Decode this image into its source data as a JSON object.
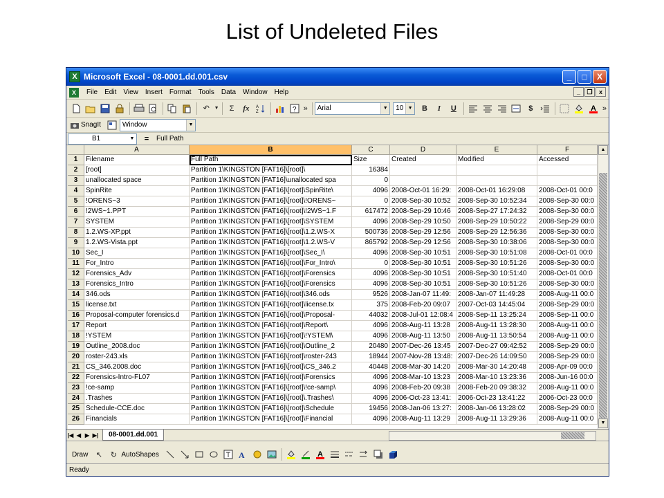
{
  "slide_title": "List of Undeleted Files",
  "window": {
    "title": "Microsoft Excel - 08-0001.dd.001.csv",
    "app_icon": "X",
    "minimize_glyph": "_",
    "maximize_glyph": "□",
    "close_glyph": "X"
  },
  "menubar": {
    "items": [
      "File",
      "Edit",
      "View",
      "Insert",
      "Format",
      "Tools",
      "Data",
      "Window",
      "Help"
    ],
    "doc_minimize": "_",
    "doc_restore": "❐",
    "doc_close": "x"
  },
  "toolbar1": {
    "font_name": "Arial",
    "font_size": "10",
    "bold": "B",
    "italic": "I",
    "underline": "U",
    "sigma": "Σ",
    "fx": "fx",
    "currency": "$",
    "more": "»"
  },
  "toolbar2": {
    "snagit_label": "SnagIt",
    "capture_mode": "Window"
  },
  "formula_bar": {
    "cell_ref": "B1",
    "equals": "=",
    "value": "Full Path"
  },
  "columns": [
    "A",
    "B",
    "C",
    "D",
    "E",
    "F"
  ],
  "rows": [
    {
      "n": "1",
      "a": "Filename",
      "b": "Full Path",
      "c": "Size",
      "d": "Created",
      "e": "Modified",
      "f": "Accessed",
      "c_text": true
    },
    {
      "n": "2",
      "a": "[root]",
      "b": "Partition 1\\KINGSTON [FAT16]\\[root]\\",
      "c": "16384",
      "d": "",
      "e": "",
      "f": ""
    },
    {
      "n": "3",
      "a": "unallocated space",
      "b": "Partition 1\\KINGSTON [FAT16]\\unallocated spa",
      "c": "0",
      "d": "",
      "e": "",
      "f": ""
    },
    {
      "n": "4",
      "a": "SpinRite",
      "b": "Partition 1\\KINGSTON [FAT16]\\[root]\\SpinRite\\",
      "c": "4096",
      "d": "2008-Oct-01 16:29:",
      "e": "2008-Oct-01 16:29:08",
      "f": "2008-Oct-01 00:0"
    },
    {
      "n": "5",
      "a": "!ORENS~3",
      "b": "Partition 1\\KINGSTON [FAT16]\\[root]\\!ORENS~",
      "c": "0",
      "d": "2008-Sep-30 10:52",
      "e": "2008-Sep-30 10:52:34",
      "f": "2008-Sep-30 00:0"
    },
    {
      "n": "6",
      "a": "!2WS~1.PPT",
      "b": "Partition 1\\KINGSTON [FAT16]\\[root]\\!2WS~1.F",
      "c": "617472",
      "d": "2008-Sep-29 10:46",
      "e": "2008-Sep-27 17:24:32",
      "f": "2008-Sep-30 00:0"
    },
    {
      "n": "7",
      "a": "SYSTEM",
      "b": "Partition 1\\KINGSTON [FAT16]\\[root]\\SYSTEM",
      "c": "4096",
      "d": "2008-Sep-29 10:50",
      "e": "2008-Sep-29 10:50:22",
      "f": "2008-Sep-29 00:0"
    },
    {
      "n": "8",
      "a": "1.2.WS-XP.ppt",
      "b": "Partition 1\\KINGSTON [FAT16]\\[root]\\1.2.WS-X",
      "c": "500736",
      "d": "2008-Sep-29 12:56",
      "e": "2008-Sep-29 12:56:36",
      "f": "2008-Sep-30 00:0"
    },
    {
      "n": "9",
      "a": "1.2.WS-Vista.ppt",
      "b": "Partition 1\\KINGSTON [FAT16]\\[root]\\1.2.WS-V",
      "c": "865792",
      "d": "2008-Sep-29 12:56",
      "e": "2008-Sep-30 10:38:06",
      "f": "2008-Sep-30 00:0"
    },
    {
      "n": "10",
      "a": "Sec_I",
      "b": "Partition 1\\KINGSTON [FAT16]\\[root]\\Sec_I\\",
      "c": "4096",
      "d": "2008-Sep-30 10:51",
      "e": "2008-Sep-30 10:51:08",
      "f": "2008-Oct-01 00:0"
    },
    {
      "n": "11",
      "a": "For_Intro",
      "b": "Partition 1\\KINGSTON [FAT16]\\[root]\\For_Intro\\",
      "c": "0",
      "d": "2008-Sep-30 10:51",
      "e": "2008-Sep-30 10:51:26",
      "f": "2008-Sep-30 00:0"
    },
    {
      "n": "12",
      "a": "Forensics_Adv",
      "b": "Partition 1\\KINGSTON [FAT16]\\[root]\\Forensics",
      "c": "4096",
      "d": "2008-Sep-30 10:51",
      "e": "2008-Sep-30 10:51:40",
      "f": "2008-Oct-01 00:0"
    },
    {
      "n": "13",
      "a": "Forensics_Intro",
      "b": "Partition 1\\KINGSTON [FAT16]\\[root]\\Forensics",
      "c": "4096",
      "d": "2008-Sep-30 10:51",
      "e": "2008-Sep-30 10:51:26",
      "f": "2008-Sep-30 00:0"
    },
    {
      "n": "14",
      "a": "346.ods",
      "b": "Partition 1\\KINGSTON [FAT16]\\[root]\\346.ods",
      "c": "9526",
      "d": "2008-Jan-07 11:49:",
      "e": "2008-Jan-07 11:49:28",
      "f": "2008-Aug-11 00:0"
    },
    {
      "n": "15",
      "a": "license.txt",
      "b": "Partition 1\\KINGSTON [FAT16]\\[root]\\license.tx",
      "c": "375",
      "d": "2008-Feb-20 09:07",
      "e": "2007-Oct-03 14:45:04",
      "f": "2008-Sep-29 00:0"
    },
    {
      "n": "16",
      "a": "Proposal-computer forensics.d",
      "b": "Partition 1\\KINGSTON [FAT16]\\[root]\\Proposal-",
      "c": "44032",
      "d": "2008-Jul-01 12:08:4",
      "e": "2008-Sep-11 13:25:24",
      "f": "2008-Sep-11 00:0"
    },
    {
      "n": "17",
      "a": "Report",
      "b": "Partition 1\\KINGSTON [FAT16]\\[root]\\Report\\",
      "c": "4096",
      "d": "2008-Aug-11 13:28",
      "e": "2008-Aug-11 13:28:30",
      "f": "2008-Aug-11 00:0"
    },
    {
      "n": "18",
      "a": "!YSTEM",
      "b": "Partition 1\\KINGSTON [FAT16]\\[root]\\!YSTEM\\",
      "c": "4096",
      "d": "2008-Aug-11 13:50",
      "e": "2008-Aug-11 13:50:54",
      "f": "2008-Aug-11 00:0"
    },
    {
      "n": "19",
      "a": "Outline_2008.doc",
      "b": "Partition 1\\KINGSTON [FAT16]\\[root]\\Outline_2",
      "c": "20480",
      "d": "2007-Dec-26 13:45",
      "e": "2007-Dec-27 09:42:52",
      "f": "2008-Sep-29 00:0"
    },
    {
      "n": "20",
      "a": "roster-243.xls",
      "b": "Partition 1\\KINGSTON [FAT16]\\[root]\\roster-243",
      "c": "18944",
      "d": "2007-Nov-28 13:48:",
      "e": "2007-Dec-26 14:09:50",
      "f": "2008-Sep-29 00:0"
    },
    {
      "n": "21",
      "a": "CS_346.2008.doc",
      "b": "Partition 1\\KINGSTON [FAT16]\\[root]\\CS_346.2",
      "c": "40448",
      "d": "2008-Mar-30 14:20",
      "e": "2008-Mar-30 14:20:48",
      "f": "2008-Apr-09 00:0"
    },
    {
      "n": "22",
      "a": "Forensics-Intro-FL07",
      "b": "Partition 1\\KINGSTON [FAT16]\\[root]\\Forensics",
      "c": "4096",
      "d": "2008-Mar-10 13:23",
      "e": "2008-Mar-10 13:23:36",
      "f": "2008-Jun-16 00:0"
    },
    {
      "n": "23",
      "a": "!ce-samp",
      "b": "Partition 1\\KINGSTON [FAT16]\\[root]\\!ce-samp\\",
      "c": "4096",
      "d": "2008-Feb-20 09:38",
      "e": "2008-Feb-20 09:38:32",
      "f": "2008-Aug-11 00:0"
    },
    {
      "n": "24",
      "a": ".Trashes",
      "b": "Partition 1\\KINGSTON [FAT16]\\[root]\\.Trashes\\",
      "c": "4096",
      "d": "2006-Oct-23 13:41:",
      "e": "2006-Oct-23 13:41:22",
      "f": "2006-Oct-23 00:0"
    },
    {
      "n": "25",
      "a": "Schedule-CCE.doc",
      "b": "Partition 1\\KINGSTON [FAT16]\\[root]\\Schedule",
      "c": "19456",
      "d": "2008-Jan-06 13:27:",
      "e": "2008-Jan-06 13:28:02",
      "f": "2008-Sep-29 00:0"
    },
    {
      "n": "26",
      "a": "Financials",
      "b": "Partition 1\\KINGSTON [FAT16]\\[root]\\Financial",
      "c": "4096",
      "d": "2008-Aug-11 13:29",
      "e": "2008-Aug-11 13:29:36",
      "f": "2008-Aug-11 00:0"
    }
  ],
  "sheet_tab": "08-0001.dd.001",
  "drawbar": {
    "draw_label": "Draw",
    "autoshapes_label": "AutoShapes"
  },
  "status": "Ready",
  "colors": {
    "title_bar": "#0a5ad6",
    "selected_header": "#ffc069",
    "chrome": "#ece9d8"
  }
}
